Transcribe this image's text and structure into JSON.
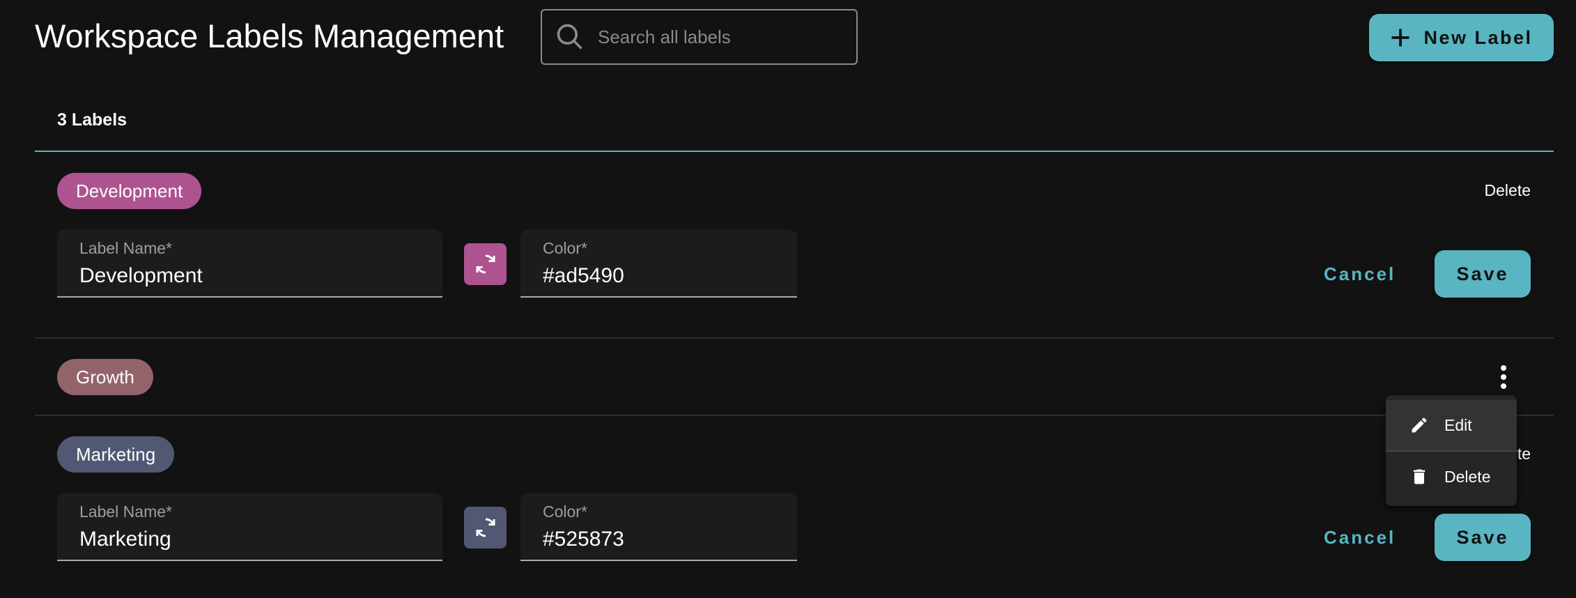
{
  "header": {
    "title": "Workspace Labels Management",
    "search_placeholder": "Search all labels",
    "search_value": "",
    "new_label_button": "New Label"
  },
  "count_label": "3 Labels",
  "colors": {
    "accent": "#59b5c2",
    "background": "#121212"
  },
  "labels": [
    {
      "name": "Development",
      "color": "#ad5490",
      "editing": true,
      "delete_label": "Delete",
      "field_name_label": "Label Name*",
      "field_color_label": "Color*",
      "name_value": "Development",
      "color_value": "#ad5490",
      "cancel_label": "Cancel",
      "save_label": "Save"
    },
    {
      "name": "Growth",
      "color": "#93636b",
      "editing": false
    },
    {
      "name": "Marketing",
      "color": "#525873",
      "editing": true,
      "delete_label": "Delete",
      "field_name_label": "Label Name*",
      "field_color_label": "Color*",
      "name_value": "Marketing",
      "color_value": "#525873",
      "cancel_label": "Cancel",
      "save_label": "Save"
    }
  ],
  "context_menu": {
    "items": [
      {
        "label": "Edit",
        "icon": "pencil-icon"
      },
      {
        "label": "Delete",
        "icon": "trash-icon"
      }
    ]
  }
}
